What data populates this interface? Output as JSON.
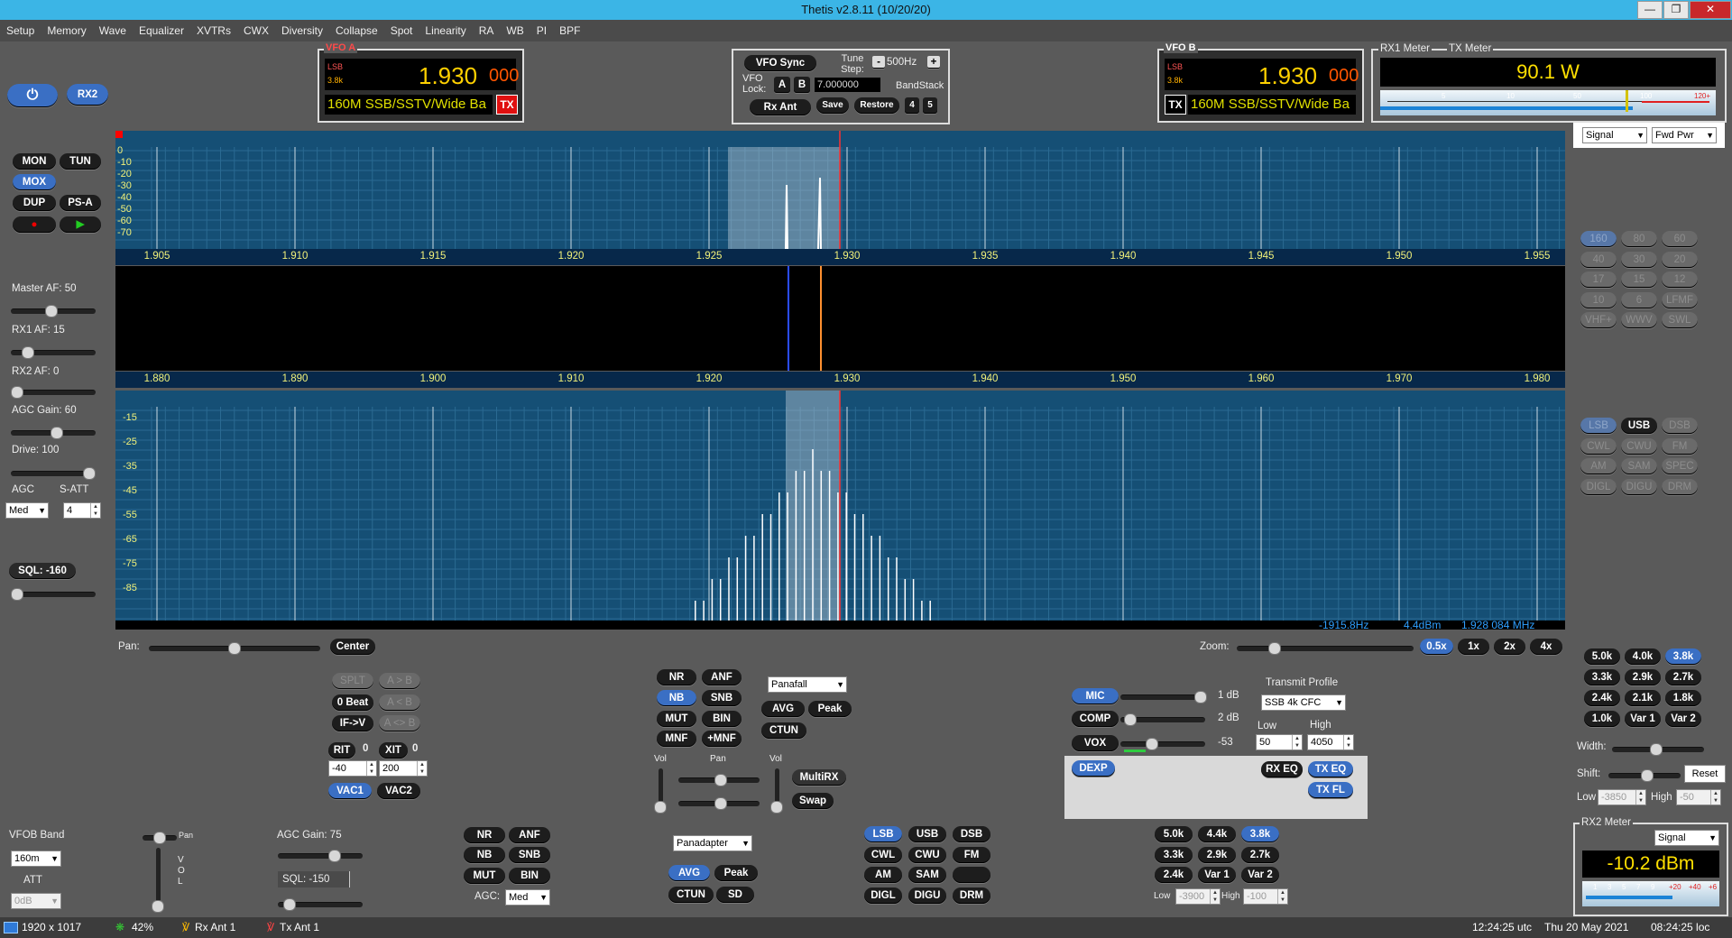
{
  "window": {
    "title": "Thetis v2.8.11 (10/20/20)"
  },
  "menu": [
    "Setup",
    "Memory",
    "Wave",
    "Equalizer",
    "XVTRs",
    "CWX",
    "Diversity",
    "Collapse",
    "Spot",
    "Linearity",
    "RA",
    "WB",
    "PI",
    "BPF"
  ],
  "left": {
    "rx2": "RX2",
    "mon": "MON",
    "tun": "TUN",
    "mox": "MOX",
    "dup": "DUP",
    "psa": "PS-A",
    "master_af": "Master AF:  50",
    "rx1_af": "RX1 AF:  15",
    "rx2_af": "RX2 AF:  0",
    "agc_gain": "AGC Gain:  60",
    "drive": "Drive:  100",
    "agc_label": "AGC",
    "satt_label": "S-ATT",
    "agc_value": "Med",
    "satt_value": "4",
    "sql": "SQL:  -160"
  },
  "vfoa": {
    "label": "VFO A",
    "mode": "LSB",
    "bw": "3.8k",
    "freq": "1.930",
    "freq_sub": "000",
    "band_text": "160M SSB/SSTV/Wide Ba",
    "tx": "TX"
  },
  "vfob": {
    "label": "VFO B",
    "mode": "LSB",
    "bw": "3.8k",
    "freq": "1.930",
    "freq_sub": "000",
    "band_text": "160M SSB/SSTV/Wide Ba",
    "tx": "TX"
  },
  "center": {
    "vfo_sync": "VFO Sync",
    "tune_step_label": "Tune Step:",
    "tune_step": "500Hz",
    "vfo_lock": "VFO Lock:",
    "a": "A",
    "b": "B",
    "freq_field": "7.000000",
    "bandstack": "BandStack",
    "rx_ant": "Rx Ant",
    "save": "Save",
    "restore": "Restore",
    "bs4": "4",
    "bs5": "5"
  },
  "meters": {
    "rx1_meter": "RX1 Meter",
    "tx_meter": "TX Meter",
    "power": "90.1 W",
    "scale": [
      "5",
      "10",
      "50",
      "100",
      "120+"
    ],
    "signal": "Signal",
    "fwd_pwr": "Fwd Pwr"
  },
  "pan_top": {
    "freqs": [
      "1.905",
      "1.910",
      "1.915",
      "1.920",
      "1.925",
      "1.930",
      "1.935",
      "1.940",
      "1.945",
      "1.950",
      "1.955"
    ],
    "db": [
      "0",
      "-10",
      "-20",
      "-30",
      "-40",
      "-50",
      "-60",
      "-70"
    ]
  },
  "pan_bottom": {
    "freqs": [
      "1.880",
      "1.890",
      "1.900",
      "1.910",
      "1.920",
      "1.930",
      "1.940",
      "1.950",
      "1.960",
      "1.970",
      "1.980"
    ],
    "db": [
      "-15",
      "-25",
      "-35",
      "-45",
      "-55",
      "-65",
      "-75",
      "-85"
    ],
    "readout": [
      "-1915.8Hz",
      "4.4dBm",
      "1.928 084 MHz"
    ]
  },
  "bands": [
    "160",
    "80",
    "60",
    "40",
    "30",
    "20",
    "17",
    "15",
    "12",
    "10",
    "6",
    "LFMF",
    "VHF+",
    "WWV",
    "SWL"
  ],
  "modes": [
    "LSB",
    "USB",
    "DSB",
    "CWL",
    "CWU",
    "FM",
    "AM",
    "SAM",
    "SPEC",
    "DIGL",
    "DIGU",
    "DRM"
  ],
  "filters": [
    "5.0k",
    "4.0k",
    "3.8k",
    "3.3k",
    "2.9k",
    "2.7k",
    "2.4k",
    "2.1k",
    "1.8k",
    "1.0k",
    "Var 1",
    "Var 2"
  ],
  "filter_ctrl": {
    "width": "Width:",
    "shift": "Shift:",
    "reset": "Reset",
    "low": "Low",
    "low_val": "-3850",
    "high": "High",
    "high_val": "-50"
  },
  "pan_bar": {
    "pan": "Pan:",
    "center": "Center",
    "zoom": "Zoom:",
    "z05": "0.5x",
    "z1": "1x",
    "z2": "2x",
    "z4": "4x"
  },
  "mid_left": {
    "split": "SPLT",
    "atob": "A > B",
    "zbeat": "0 Beat",
    "btoa": "A < B",
    "ifv": "IF->V",
    "aswap": "A <> B",
    "rit": "RIT",
    "rit_v": "0",
    "xit": "XIT",
    "xit_v": "0",
    "rit_field": "-40",
    "xit_field": "200",
    "vac1": "VAC1",
    "vac2": "VAC2"
  },
  "dsp": {
    "nr": "NR",
    "anf": "ANF",
    "nb": "NB",
    "snb": "SNB",
    "mut": "MUT",
    "bin": "BIN",
    "mnf": "MNF",
    "pmnf": "+MNF",
    "display_mode": "Panafall",
    "avg": "AVG",
    "peak": "Peak",
    "ctun": "CTUN",
    "vol": "Vol",
    "pan": "Pan",
    "vol2": "Vol",
    "multirx": "MultiRX",
    "swap": "Swap"
  },
  "tx": {
    "mic": "MIC",
    "mic_db": "1 dB",
    "comp": "COMP",
    "comp_db": "2 dB",
    "vox": "VOX",
    "vox_v": "-53",
    "dexp": "DEXP",
    "profile_label": "Transmit Profile",
    "profile": "SSB 4k CFC",
    "low": "Low",
    "high": "High",
    "low_v": "50",
    "high_v": "4050",
    "rxeq": "RX EQ",
    "txeq": "TX EQ",
    "txfl": "TX FL"
  },
  "rx2": {
    "vfob_band": "VFOB Band",
    "band": "160m",
    "att": "ATT",
    "att_v": "0dB",
    "pan": "Pan",
    "vol": "VOL",
    "agc_gain": "AGC Gain:  75",
    "sql": "SQL:  -150",
    "nr": "NR",
    "anf": "ANF",
    "nb": "NB",
    "snb": "SNB",
    "mut": "MUT",
    "bin": "BIN",
    "agc": "AGC:",
    "agc_v": "Med",
    "display": "Panadapter",
    "avg": "AVG",
    "peak": "Peak",
    "ctun": "CTUN",
    "sd": "SD",
    "modes": [
      "LSB",
      "USB",
      "DSB",
      "CWL",
      "CWU",
      "FM",
      "AM",
      "SAM",
      "",
      "DIGL",
      "DIGU",
      "DRM"
    ],
    "filters": [
      "5.0k",
      "4.4k",
      "3.8k",
      "3.3k",
      "2.9k",
      "2.7k",
      "2.4k",
      "Var 1",
      "Var 2"
    ],
    "low": "Low",
    "low_v": "-3900",
    "high": "High",
    "high_v": "-100",
    "meter_label": "RX2 Meter",
    "meter_sel": "Signal",
    "meter_value": "-10.2 dBm",
    "meter_scale": [
      "1",
      "3",
      "5",
      "7",
      "9",
      "+20",
      "+40",
      "+6"
    ]
  },
  "status": {
    "res": "1920 x 1017",
    "cpu": "42%",
    "rx_ant": "Rx Ant  1",
    "tx_ant": "Tx Ant  1",
    "utc": "12:24:25 utc",
    "date": "Thu 20 May 2021",
    "loc": "08:24:25 loc"
  },
  "colors": {
    "pan_bg": "#154f75",
    "scale_text": "#f2f27a",
    "filter": "#b9c8d4",
    "tx_line": "#ff3030"
  }
}
